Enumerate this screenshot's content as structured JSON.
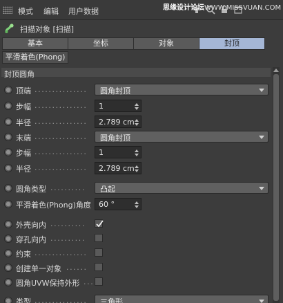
{
  "menu": {
    "items": [
      "模式",
      "编辑",
      "用户数据"
    ]
  },
  "watermark": {
    "part1": "思缘设计论坛",
    "part2": "WWW.MISSVUAN.COM"
  },
  "object": {
    "title": "扫描对象 [扫描]"
  },
  "tabs": [
    "基本",
    "坐标",
    "对象",
    "封顶"
  ],
  "active_tab": "封顶",
  "subtab": "平滑着色(Phong)",
  "section": {
    "title": "封顶圆角"
  },
  "rows": {
    "top": {
      "label": "顶端",
      "value": "圆角封顶"
    },
    "top_steps": {
      "label": "步幅",
      "value": "1"
    },
    "top_radius": {
      "label": "半径",
      "value": "2.789 cm"
    },
    "end": {
      "label": "末端",
      "value": "圆角封顶"
    },
    "end_steps": {
      "label": "步幅",
      "value": "1"
    },
    "end_radius": {
      "label": "半径",
      "value": "2.789 cm"
    },
    "fillet_type": {
      "label": "圆角类型",
      "value": "凸起"
    },
    "phong_angle": {
      "label": "平滑着色(Phong)角度",
      "value": "60 °"
    },
    "hull_inward": {
      "label": "外壳向内",
      "checked": true
    },
    "hole_inward": {
      "label": "穿孔向内",
      "checked": false
    },
    "constrain": {
      "label": "约束",
      "checked": false
    },
    "single_object": {
      "label": "创建单一对象",
      "checked": false
    },
    "uvw_shape": {
      "label": "圆角UVW保持外形",
      "checked": false
    },
    "type": {
      "label": "类型",
      "value": "三角形"
    }
  },
  "colors": {
    "active_tab": "#a5b7d6",
    "panel": "#3c3c3c",
    "field": "#2e2e2e",
    "dropdown": "#606060"
  }
}
